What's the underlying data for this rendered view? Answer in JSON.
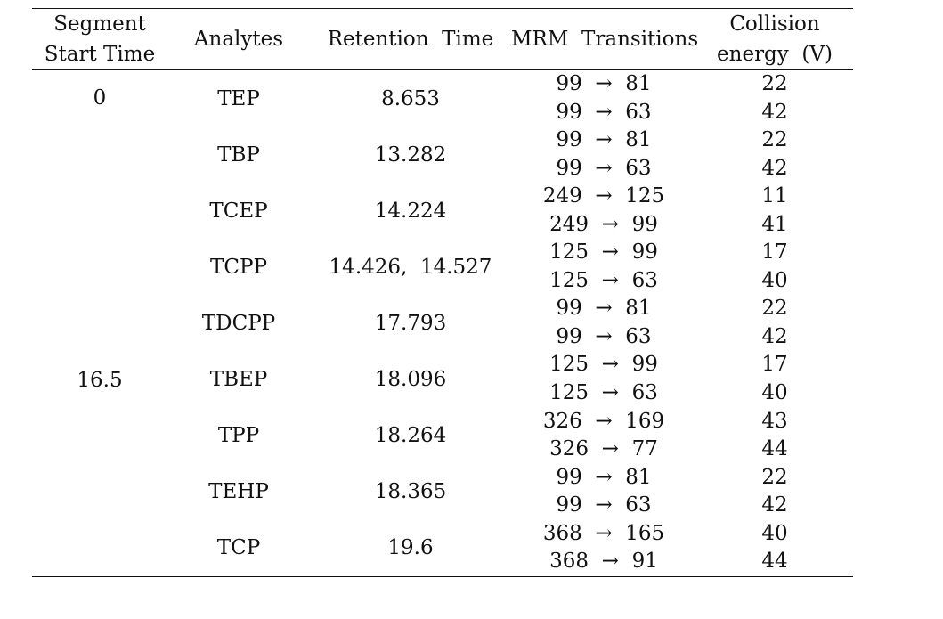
{
  "table": {
    "headers": {
      "segment_start_time": [
        "Segment",
        "Start Time"
      ],
      "analytes": "Analytes",
      "retention_time": "Retention  Time",
      "mrm_transitions": "MRM  Transitions",
      "collision_energy": [
        "Collision",
        "energy  (V)"
      ]
    },
    "segments": [
      {
        "start_time": "0",
        "rows": [
          0
        ]
      },
      {
        "start_time": "16.5",
        "rows": [
          1,
          2,
          3,
          4,
          5,
          6,
          7,
          8
        ]
      }
    ],
    "rows": [
      {
        "analyte": "TEP",
        "retention_time": "8.653",
        "transitions": [
          "99  →  81",
          "99  →  63"
        ],
        "collision_energy": [
          "22",
          "42"
        ]
      },
      {
        "analyte": "TBP",
        "retention_time": "13.282",
        "transitions": [
          "99  →  81",
          "99  →  63"
        ],
        "collision_energy": [
          "22",
          "42"
        ]
      },
      {
        "analyte": "TCEP",
        "retention_time": "14.224",
        "transitions": [
          "249  →  125",
          "249  →  99"
        ],
        "collision_energy": [
          "11",
          "41"
        ]
      },
      {
        "analyte": "TCPP",
        "retention_time": "14.426,  14.527",
        "transitions": [
          "125  →  99",
          "125  →  63"
        ],
        "collision_energy": [
          "17",
          "40"
        ]
      },
      {
        "analyte": "TDCPP",
        "retention_time": "17.793",
        "transitions": [
          "99  →  81",
          "99  →  63"
        ],
        "collision_energy": [
          "22",
          "42"
        ]
      },
      {
        "analyte": "TBEP",
        "retention_time": "18.096",
        "transitions": [
          "125  →  99",
          "125  →  63"
        ],
        "collision_energy": [
          "17",
          "40"
        ]
      },
      {
        "analyte": "TPP",
        "retention_time": "18.264",
        "transitions": [
          "326  →  169",
          "326  →  77"
        ],
        "collision_energy": [
          "43",
          "44"
        ]
      },
      {
        "analyte": "TEHP",
        "retention_time": "18.365",
        "transitions": [
          "99  →  81",
          "99  →  63"
        ],
        "collision_energy": [
          "22",
          "42"
        ]
      },
      {
        "analyte": "TCP",
        "retention_time": "19.6",
        "transitions": [
          "368  →  165",
          "368  →  91"
        ],
        "collision_energy": [
          "40",
          "44"
        ]
      }
    ]
  }
}
